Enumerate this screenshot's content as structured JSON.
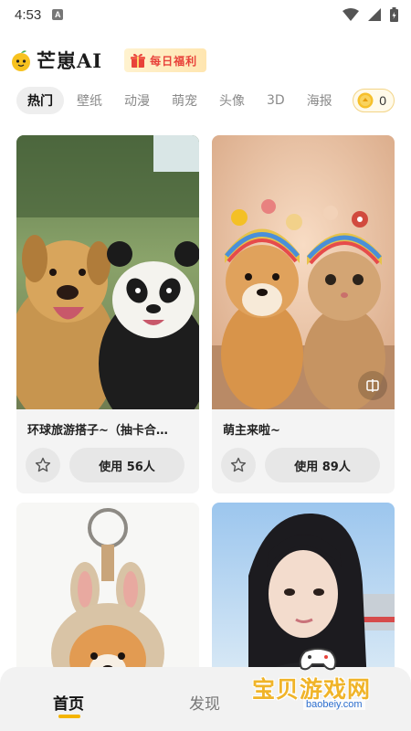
{
  "status_bar": {
    "time": "4:53",
    "notification_letter": "A"
  },
  "header": {
    "app_title": "芒崽AI",
    "daily_badge": "每日福利"
  },
  "tabs": [
    {
      "label": "热门",
      "active": true
    },
    {
      "label": "壁纸"
    },
    {
      "label": "动漫"
    },
    {
      "label": "萌宠"
    },
    {
      "label": "头像"
    },
    {
      "label": "3D"
    },
    {
      "label": "海报"
    }
  ],
  "coins": {
    "count": "0"
  },
  "cards": [
    {
      "title": "环球旅游搭子~（抽卡合…",
      "use_label": "使用 56人",
      "image": "dog-and-panda-selfie"
    },
    {
      "title": "萌主来啦~",
      "use_label": "使用 89人",
      "image": "shiba-and-cat-knit-hats"
    },
    {
      "image": "corgi-bunny-keychain"
    },
    {
      "image": "girl-racetrack-portrait"
    }
  ],
  "bottom_nav": {
    "home": "首页",
    "discover": "发现"
  },
  "watermark": {
    "text": "宝贝游戏网",
    "url": "baobeiy.com"
  },
  "colors": {
    "accent": "#f4b400",
    "badge_red": "#e8423a",
    "watermark_gold": "#f0b429"
  }
}
